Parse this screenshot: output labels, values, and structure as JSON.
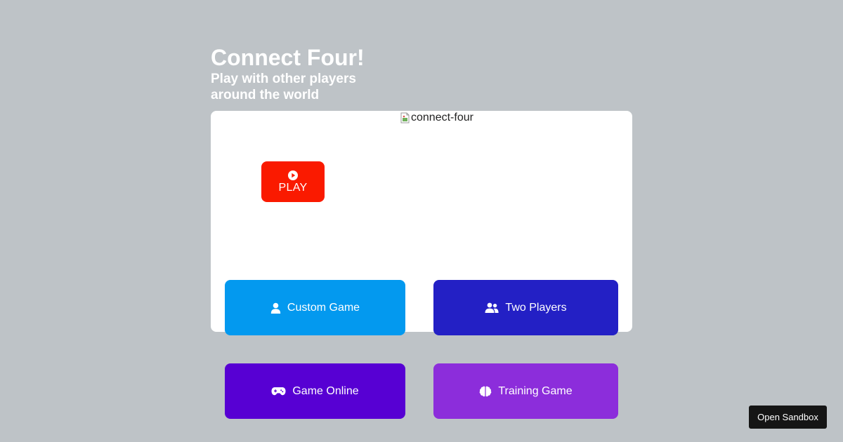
{
  "header": {
    "title": "Connect Four!",
    "subtitle": "Play with other players around the world"
  },
  "card": {
    "image_alt": "connect-four",
    "play_label": "PLAY"
  },
  "modes": {
    "custom_game": "Custom Game",
    "two_players": "Two Players",
    "game_online": "Game Online",
    "training_game": "Training Game"
  },
  "icons": {
    "play": "play-circle-icon",
    "custom_game": "user-icon",
    "two_players": "users-icon",
    "game_online": "gamepad-icon",
    "training_game": "brain-icon"
  },
  "sandbox": {
    "label": "Open Sandbox"
  },
  "colors": {
    "background": "#bec3c7",
    "play": "#fa1a00",
    "custom_game": "#0399ef",
    "two_players": "#2320c5",
    "game_online": "#5700d3",
    "training_game": "#8c2ddb",
    "sandbox": "#151515"
  }
}
